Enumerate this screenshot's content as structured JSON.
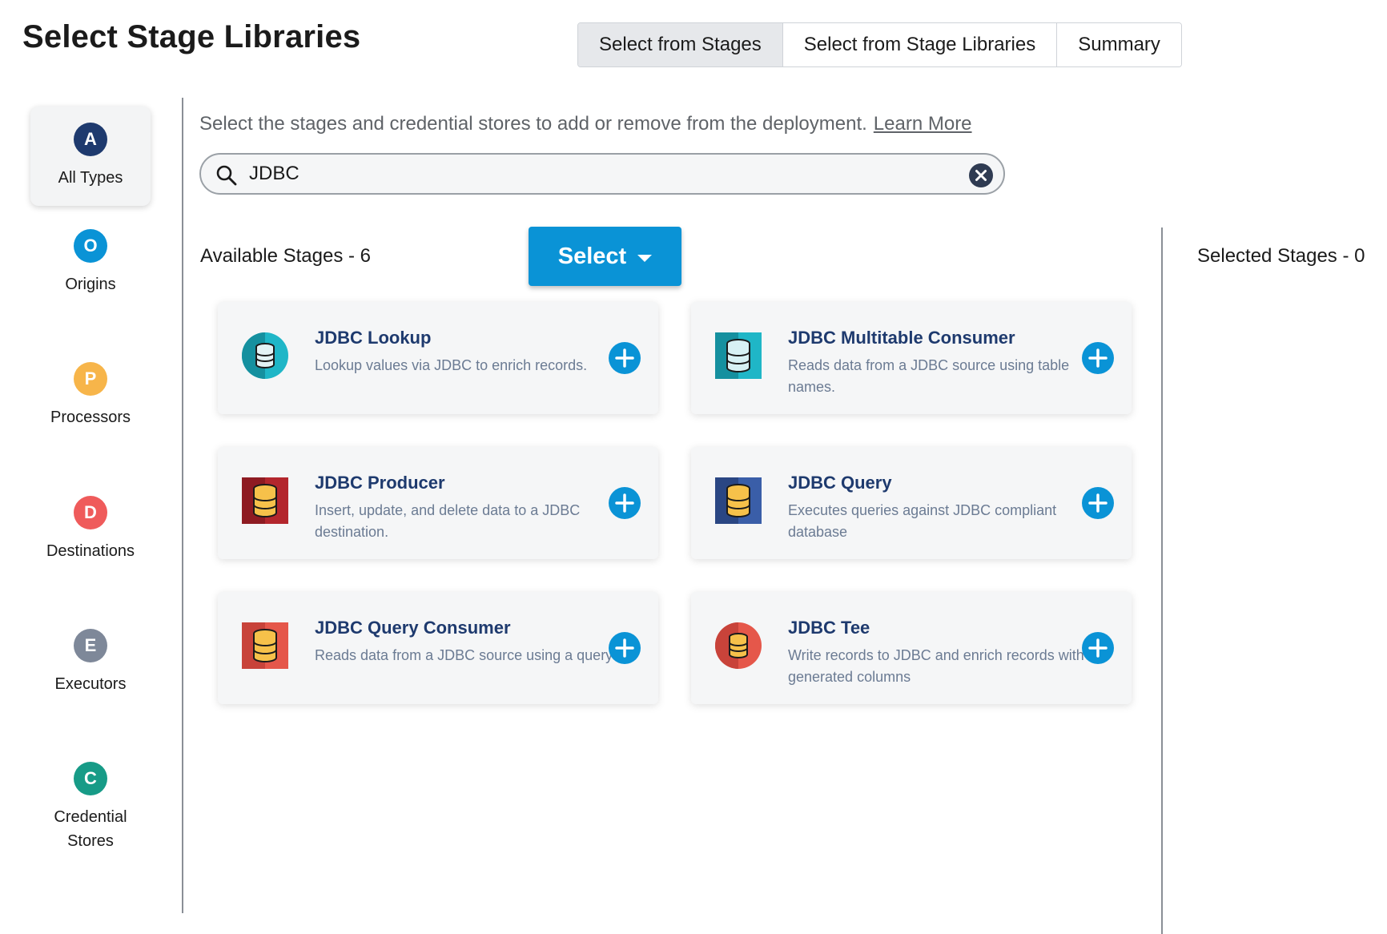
{
  "page_title": "Select Stage Libraries",
  "tabs": [
    {
      "label": "Select from Stages",
      "active": true
    },
    {
      "label": "Select from Stage Libraries",
      "active": false
    },
    {
      "label": "Summary",
      "active": false
    }
  ],
  "type_nav": [
    {
      "letter": "A",
      "label": "All Types",
      "color": "#1e3a6e",
      "active": true
    },
    {
      "letter": "O",
      "label": "Origins",
      "color": "#0a93d6",
      "active": false
    },
    {
      "letter": "P",
      "label": "Processors",
      "color": "#f7b54a",
      "active": false
    },
    {
      "letter": "D",
      "label": "Destinations",
      "color": "#ef5b5b",
      "active": false
    },
    {
      "letter": "E",
      "label": "Executors",
      "color": "#7e8899",
      "active": false
    },
    {
      "letter": "C",
      "label": "Credential\nStores",
      "color": "#179b87",
      "active": false
    }
  ],
  "instructions": {
    "text": "Select the stages and credential stores to add or remove from the deployment.",
    "link": "Learn More"
  },
  "search": {
    "value": "JDBC",
    "placeholder": ""
  },
  "available_label": "Available Stages - 6",
  "select_button": "Select",
  "selected_label": "Selected Stages - 0",
  "stages": [
    {
      "title": "JDBC Lookup",
      "description": "Lookup values via JDBC to enrich records.",
      "icon": "database-circle-teal-icon"
    },
    {
      "title": "JDBC Multitable Consumer",
      "description": "Reads data from a JDBC source using table names.",
      "icon": "database-square-teal-icon"
    },
    {
      "title": "JDBC Producer",
      "description": "Insert, update, and delete data to a JDBC destination.",
      "icon": "database-square-darkred-icon"
    },
    {
      "title": "JDBC Query",
      "description": "Executes queries against JDBC compliant database",
      "icon": "database-square-navy-icon"
    },
    {
      "title": "JDBC Query Consumer",
      "description": "Reads data from a JDBC source using a query",
      "icon": "database-square-red-icon"
    },
    {
      "title": "JDBC Tee",
      "description": "Write records to JDBC and enrich records with generated columns",
      "icon": "database-circle-red-icon"
    }
  ],
  "colors": {
    "accent": "#0a93d6",
    "card_title": "#1e3a6e",
    "card_desc": "#6b7b93"
  }
}
